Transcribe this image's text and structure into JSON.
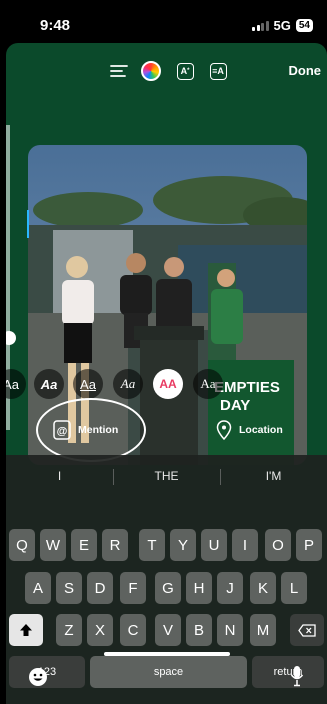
{
  "status": {
    "time": "9:48",
    "network": "5G",
    "battery": "54"
  },
  "toolbar": {
    "done_label": "Done"
  },
  "font_styles": [
    {
      "label": "Aa",
      "style": "classic"
    },
    {
      "label": "Aa",
      "style": "strong"
    },
    {
      "label": "Aa",
      "style": "modern"
    },
    {
      "label": "Aa",
      "style": "typewriter"
    },
    {
      "label": "AA",
      "style": "neon",
      "selected": true
    },
    {
      "label": "Aa",
      "style": "serif"
    }
  ],
  "stickers": {
    "mention_label": "Mention",
    "location_label": "Location"
  },
  "photo": {
    "sign_line1": "EMPTIES",
    "sign_line2": "DAY"
  },
  "suggestions": [
    "I",
    "THE",
    "I'M"
  ],
  "keyboard": {
    "row1": [
      "Q",
      "W",
      "E",
      "R",
      "T",
      "Y",
      "U",
      "I",
      "O",
      "P"
    ],
    "row2": [
      "A",
      "S",
      "D",
      "F",
      "G",
      "H",
      "J",
      "K",
      "L"
    ],
    "row3": [
      "Z",
      "X",
      "C",
      "V",
      "B",
      "N",
      "M"
    ],
    "numbers_label": "123",
    "space_label": "space",
    "return_label": "return"
  },
  "colors": {
    "sheet_bg": "#0b4a2b",
    "mention_accent": "#e83b62"
  },
  "icons": [
    "text-align-icon",
    "color-wheel-icon",
    "text-effects-icon",
    "text-animation-icon",
    "at-sign-icon",
    "location-pin-icon",
    "shift-icon",
    "backspace-icon",
    "emoji-icon",
    "microphone-icon"
  ]
}
